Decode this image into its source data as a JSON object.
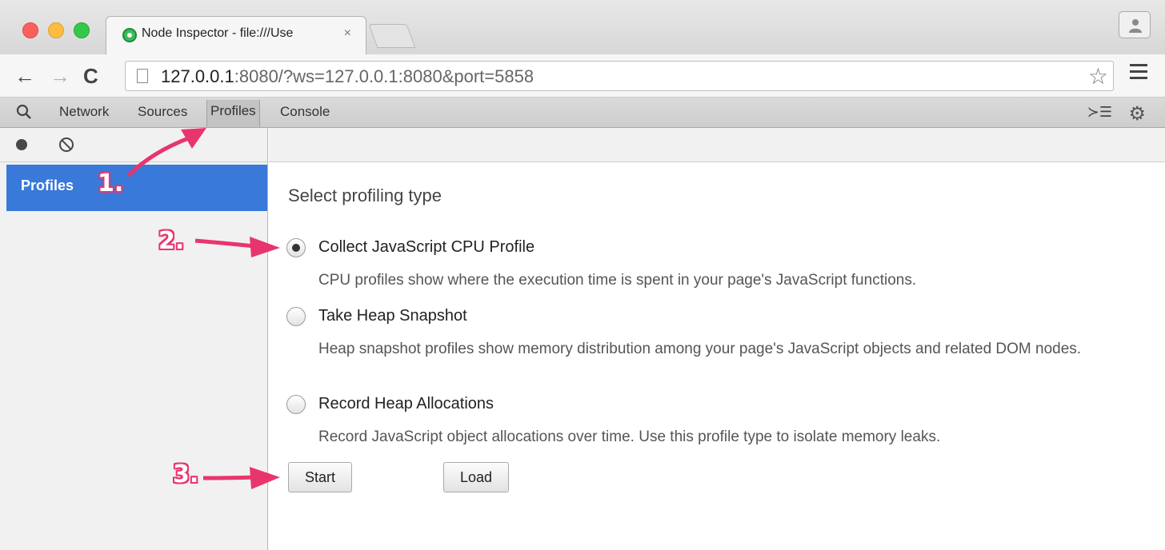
{
  "browser": {
    "tab_title": "Node Inspector - file:///Use",
    "tab_close": "×",
    "url_host": "127.0.0.1",
    "url_rest": ":8080/?ws=127.0.0.1:8080&port=5858",
    "nav": {
      "back": "←",
      "forward": "→",
      "reload": "C"
    },
    "star": "☆"
  },
  "devtools": {
    "tabs": [
      "Network",
      "Sources",
      "Profiles",
      "Console"
    ],
    "active_tab": "Profiles",
    "console_drawer_icon": "≻☰",
    "gear": "⚙"
  },
  "sidebar": {
    "item": "Profiles"
  },
  "main": {
    "heading": "Select profiling type",
    "options": [
      {
        "label": "Collect JavaScript CPU Profile",
        "desc": "CPU profiles show where the execution time is spent in your page's JavaScript functions.",
        "checked": true
      },
      {
        "label": "Take Heap Snapshot",
        "desc": "Heap snapshot profiles show memory distribution among your page's JavaScript objects and related DOM nodes.",
        "checked": false
      },
      {
        "label": "Record Heap Allocations",
        "desc": "Record JavaScript object allocations over time. Use this profile type to isolate memory leaks.",
        "checked": false
      }
    ],
    "start_label": "Start",
    "load_label": "Load"
  },
  "annotations": [
    "1.",
    "2.",
    "3."
  ],
  "colors": {
    "accent": "#3879d9",
    "annotation": "#e8356d"
  }
}
